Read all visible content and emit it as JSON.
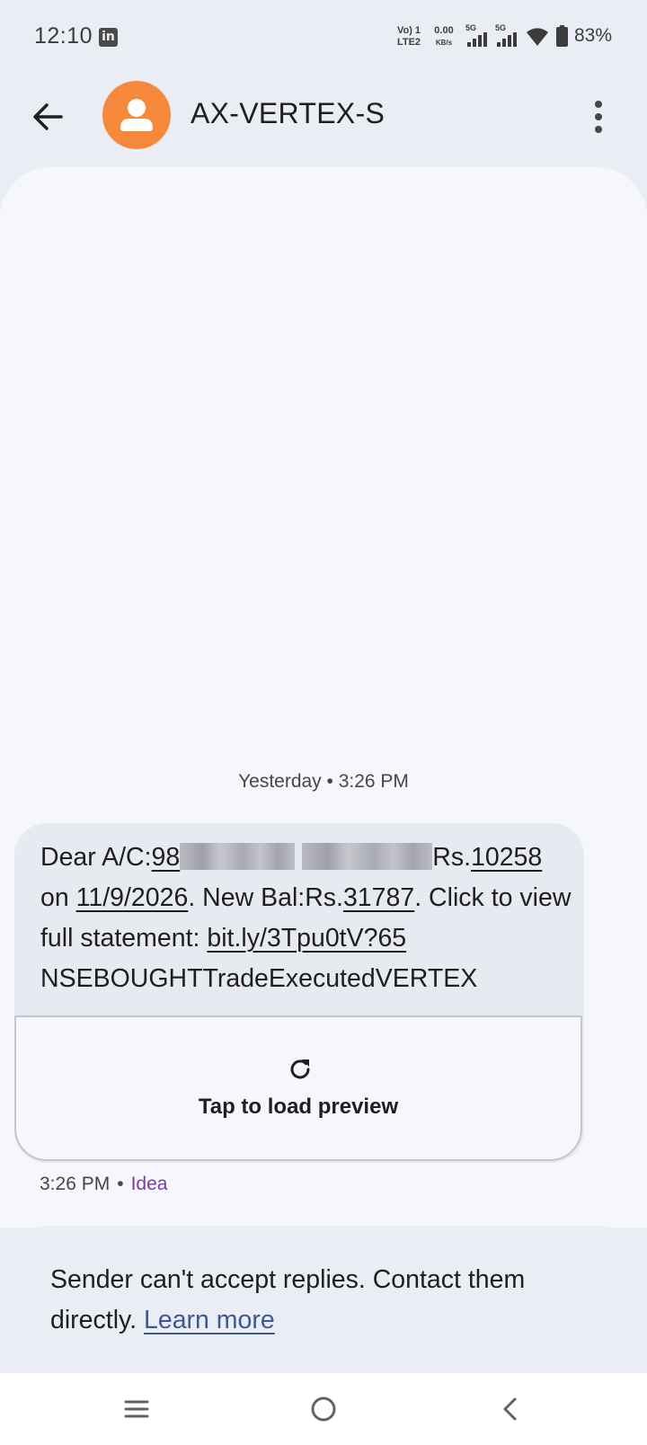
{
  "status_bar": {
    "time": "12:10",
    "notification_icon": "linkedin-icon",
    "volte_top": "Vo) 1",
    "volte_bottom": "LTE2",
    "speed_value": "0.00",
    "speed_unit": "KB/s",
    "sim1_network": "5G",
    "sim2_network": "5G",
    "battery": "83%"
  },
  "header": {
    "contact_name": "AX-VERTEX-S",
    "back_icon": "arrow-left-icon",
    "more_icon": "more-vert-icon",
    "avatar_color": "#f5883b"
  },
  "conversation": {
    "date_divider": "Yesterday • 3:26 PM",
    "message": {
      "prefix": "Dear A/C:",
      "account_visible": "98",
      "before_amount": "Rs.",
      "amount": "10258",
      "on_word": "on",
      "date": "11/9/2026",
      "balance_label": ". New Bal:Rs.",
      "balance": "31787",
      "click_text": ". Click to view full statement:",
      "link": "bit.ly/3Tpu0tV?65",
      "footer": "NSEBOUGHTTradeExecutedVERTEX"
    },
    "preview_label": "Tap to load preview",
    "meta_time": "3:26 PM",
    "meta_separator": "•",
    "meta_sim": "Idea"
  },
  "reply_banner": {
    "text": "Sender can't accept replies. Contact them directly.",
    "link_label": "Learn more"
  },
  "colors": {
    "background": "#eaedf4",
    "panel": "#f6f7fc",
    "bubble": "#e8eaf1",
    "link": "#3b5998",
    "sim_label": "#7b3aa8"
  }
}
